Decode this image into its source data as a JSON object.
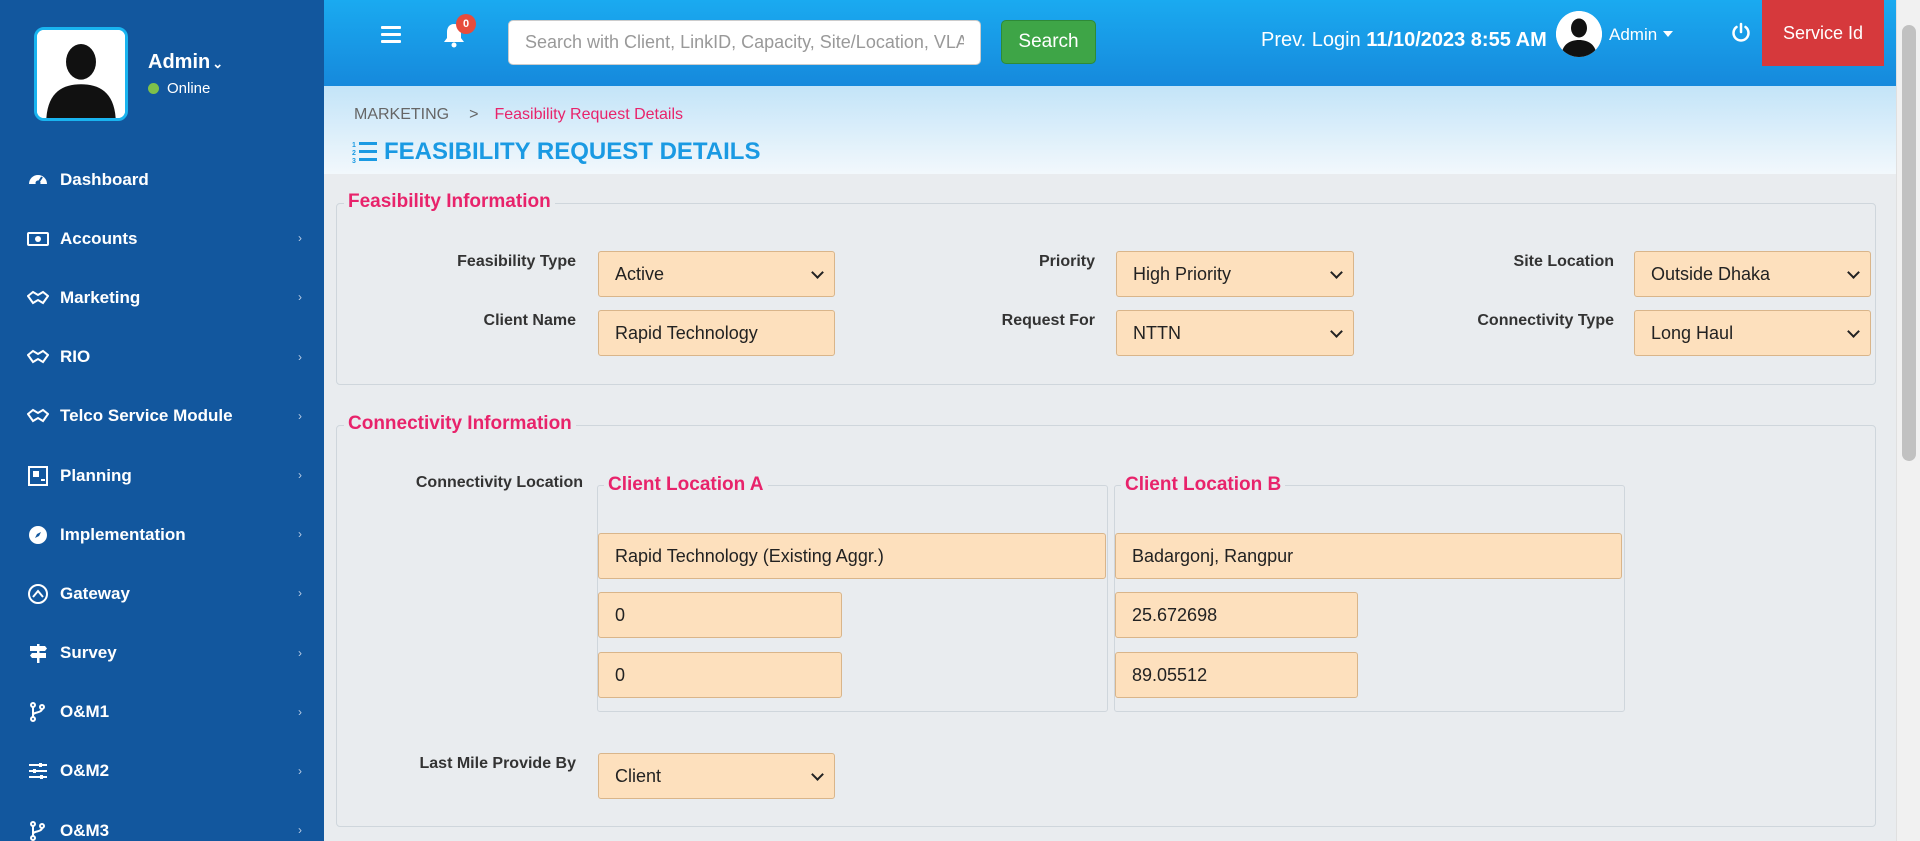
{
  "sidebar": {
    "user_name": "Admin",
    "status": "Online",
    "items": [
      {
        "label": "Dashboard",
        "icon": "dashboard-icon",
        "has_children": false
      },
      {
        "label": "Accounts",
        "icon": "money-icon",
        "has_children": true
      },
      {
        "label": "Marketing",
        "icon": "handshake-icon",
        "has_children": true
      },
      {
        "label": "RIO",
        "icon": "handshake-icon",
        "has_children": true
      },
      {
        "label": "Telco Service Module",
        "icon": "handshake-icon",
        "has_children": true
      },
      {
        "label": "Planning",
        "icon": "planning-icon",
        "has_children": true
      },
      {
        "label": "Implementation",
        "icon": "compass-icon",
        "has_children": true
      },
      {
        "label": "Gateway",
        "icon": "gateway-icon",
        "has_children": true
      },
      {
        "label": "Survey",
        "icon": "signpost-icon",
        "has_children": true
      },
      {
        "label": "O&M1",
        "icon": "branch-icon",
        "has_children": true
      },
      {
        "label": "O&M2",
        "icon": "sliders-icon",
        "has_children": true
      },
      {
        "label": "O&M3",
        "icon": "branch-icon",
        "has_children": true
      }
    ]
  },
  "topbar": {
    "notification_count": "0",
    "search_placeholder": "Search with Client, LinkID, Capacity, Site/Location, VLAN",
    "search_button": "Search",
    "prev_login_label": "Prev. Login",
    "prev_login_value": "11/10/2023 8:55 AM",
    "admin_label": "Admin",
    "service_button": "Service Id"
  },
  "breadcrumb": {
    "parent": "MARKETING",
    "separator": ">",
    "current": "Feasibility Request Details"
  },
  "page_title": "FEASIBILITY REQUEST DETAILS",
  "feasibility": {
    "legend": "Feasibility Information",
    "feasibility_type_label": "Feasibility Type",
    "feasibility_type_value": "Active",
    "priority_label": "Priority",
    "priority_value": "High Priority",
    "site_location_label": "Site Location",
    "site_location_value": "Outside Dhaka",
    "client_name_label": "Client Name",
    "client_name_value": "Rapid Technology",
    "request_for_label": "Request For",
    "request_for_value": "NTTN",
    "connectivity_type_label": "Connectivity Type",
    "connectivity_type_value": "Long Haul"
  },
  "connectivity": {
    "legend": "Connectivity Information",
    "location_label": "Connectivity Location",
    "location_a": {
      "legend": "Client Location A",
      "name": "Rapid Technology (Existing Aggr.)",
      "lat": "0",
      "lng": "0"
    },
    "location_b": {
      "legend": "Client Location B",
      "name": "Badargonj, Rangpur",
      "lat": "25.672698",
      "lng": "89.05512"
    },
    "last_mile_label": "Last Mile Provide By",
    "last_mile_value": "Client"
  },
  "colors": {
    "sidebar": "#12579e",
    "topbar": "#1a9ae3",
    "accent_pink": "#e8236b",
    "field_bg": "#fde0bd",
    "search_green": "#3ea547",
    "service_red": "#d6393c"
  }
}
